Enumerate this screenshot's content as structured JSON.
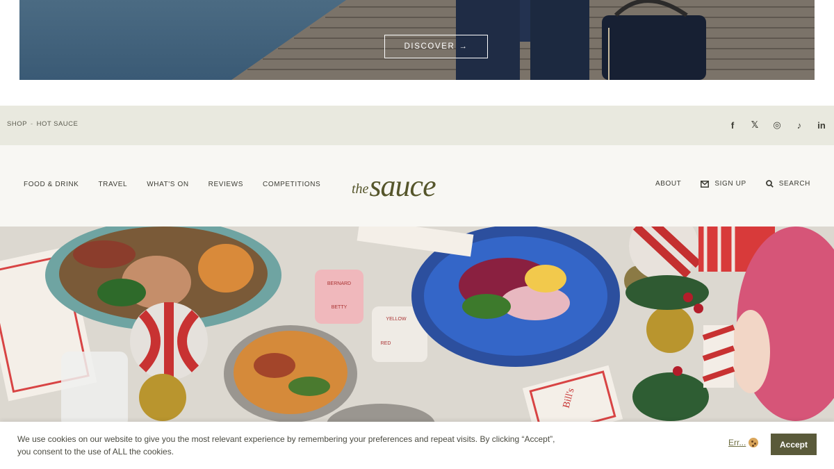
{
  "promo": {
    "discover_label": "DISCOVER",
    "arrow": "→"
  },
  "utility": {
    "shop_label": "SHOP",
    "separator": "-",
    "hot_sauce_label": "HOT SAUCE",
    "social": [
      {
        "icon": "facebook-icon",
        "glyph": "f"
      },
      {
        "icon": "x-icon",
        "glyph": "𝕏"
      },
      {
        "icon": "instagram-icon",
        "glyph": "◎"
      },
      {
        "icon": "tiktok-icon",
        "glyph": "♪"
      },
      {
        "icon": "linkedin-icon",
        "glyph": "in"
      }
    ]
  },
  "nav": {
    "left": [
      "FOOD & DRINK",
      "TRAVEL",
      "WHAT'S ON",
      "REVIEWS",
      "COMPETITIONS"
    ],
    "logo_the": "the",
    "logo_sauce": "sauce",
    "about": "ABOUT",
    "signup": "SIGN UP",
    "search": "SEARCH"
  },
  "hero": {
    "card_words": [
      "BERNARD",
      "BETTY",
      "YELLOW",
      "RED",
      "Bill's"
    ]
  },
  "cookie": {
    "text": "We use cookies on our website to give you the most relevant experience by remembering your preferences and repeat visits. By clicking “Accept”, you consent to the use of ALL the cookies.",
    "err_label": "Err...",
    "accept_label": "Accept"
  },
  "colors": {
    "utility_bg": "#e9e9df",
    "nav_bg": "#f8f7f3",
    "brand_olive": "#55552a",
    "accept_bg": "#5a5a3a"
  }
}
